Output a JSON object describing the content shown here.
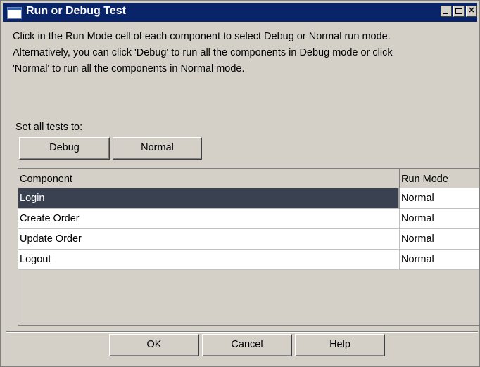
{
  "window": {
    "title": "Run or Debug Test",
    "minimize_icon": "minimize-icon",
    "maximize_icon": "maximize-icon",
    "close_icon": "close-icon"
  },
  "description": {
    "line1": "Click in the Run Mode cell of each component to select Debug or Normal run mode.",
    "line2": "Alternatively, you can click 'Debug' to run all the components in Debug mode or click",
    "line3": "'Normal' to run all the components in Normal mode."
  },
  "set_all": {
    "label": "Set all tests to:",
    "debug_label": "Debug",
    "normal_label": "Normal"
  },
  "grid": {
    "columns": [
      "Component",
      "Run Mode"
    ],
    "rows": [
      {
        "component": "Login",
        "run_mode": "Normal",
        "selected": true
      },
      {
        "component": "Create Order",
        "run_mode": "Normal",
        "selected": false
      },
      {
        "component": "Update Order",
        "run_mode": "Normal",
        "selected": false
      },
      {
        "component": "Logout",
        "run_mode": "Normal",
        "selected": false
      }
    ]
  },
  "footer": {
    "ok_label": "OK",
    "cancel_label": "Cancel",
    "help_label": "Help"
  },
  "colors": {
    "titlebar": "#0a246a",
    "selection": "#3a4252",
    "face": "#d4d0c8"
  }
}
